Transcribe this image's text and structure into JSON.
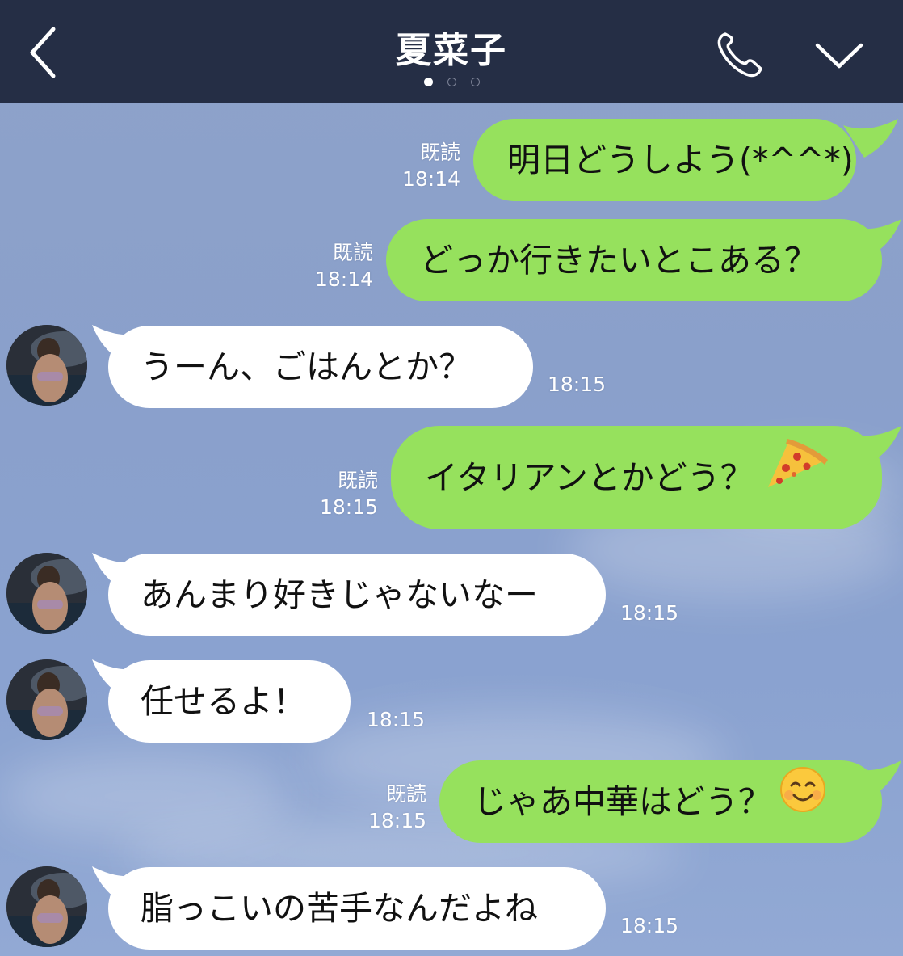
{
  "header": {
    "title": "夏菜子",
    "page_dots": 3,
    "active_dot": 0,
    "back_icon": "chevron-left-icon",
    "call_icon": "phone-icon",
    "menu_icon": "chevron-down-icon"
  },
  "colors": {
    "header_bg": "#252e45",
    "outgoing_bubble": "#96e15d",
    "incoming_bubble": "#ffffff",
    "chat_bg": "#8ea2c9"
  },
  "messages": [
    {
      "side": "out",
      "text": "明日どうしよう(*^^*)",
      "read": "既読",
      "time": "18:14"
    },
    {
      "side": "out",
      "text": "どっか行きたいとこある？",
      "read": "既読",
      "time": "18:14"
    },
    {
      "side": "in",
      "text": "うーん、ごはんとか？",
      "time": "18:15"
    },
    {
      "side": "out",
      "text": "イタリアンとかどう？",
      "emoji": "pizza-emoji",
      "read": "既読",
      "time": "18:15"
    },
    {
      "side": "in",
      "text": "あんまり好きじゃないなー",
      "time": "18:15"
    },
    {
      "side": "in",
      "text": "任せるよ！",
      "time": "18:15"
    },
    {
      "side": "out",
      "text": "じゃあ中華はどう？",
      "emoji": "smiling-face-emoji",
      "read": "既読",
      "time": "18:15"
    },
    {
      "side": "in",
      "text": "脂っこいの苦手なんだよね",
      "time": "18:15"
    }
  ]
}
